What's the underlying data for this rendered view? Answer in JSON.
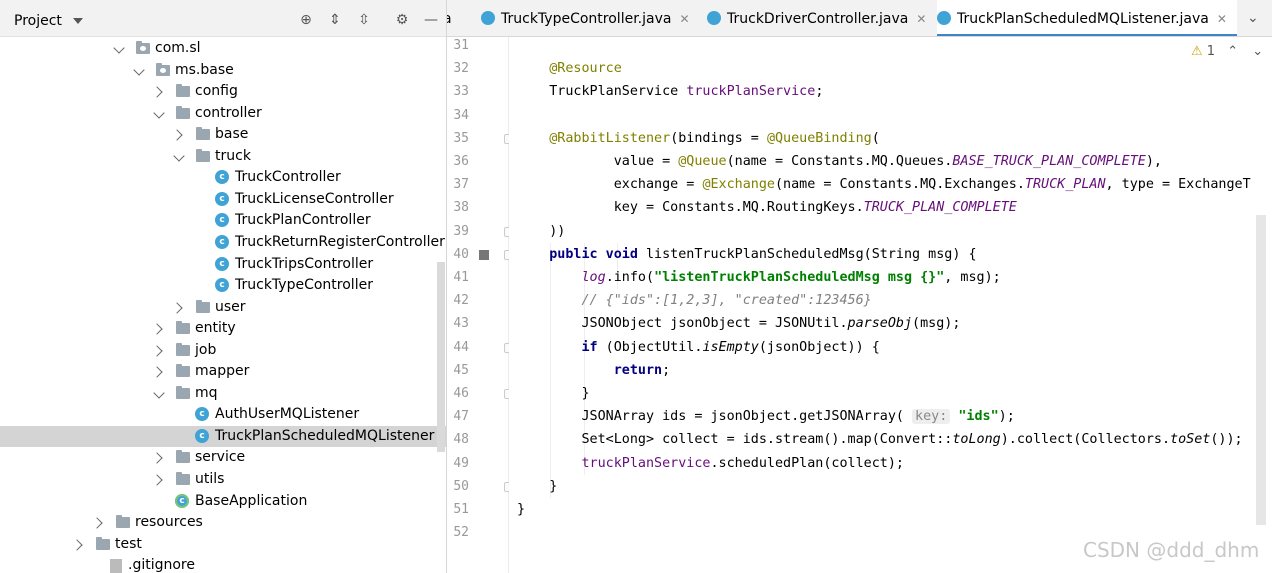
{
  "project_panel": {
    "title": "Project",
    "tree": [
      {
        "label": "com.sl",
        "type": "package",
        "expanded": true,
        "depth": 0
      },
      {
        "label": "ms.base",
        "type": "package",
        "expanded": true,
        "depth": 1
      },
      {
        "label": "config",
        "type": "folder",
        "expanded": false,
        "depth": 2
      },
      {
        "label": "controller",
        "type": "folder",
        "expanded": true,
        "depth": 2
      },
      {
        "label": "base",
        "type": "folder",
        "expanded": false,
        "depth": 3
      },
      {
        "label": "truck",
        "type": "folder",
        "expanded": true,
        "depth": 3
      },
      {
        "label": "TruckController",
        "type": "class",
        "depth": 4
      },
      {
        "label": "TruckLicenseController",
        "type": "class",
        "depth": 4
      },
      {
        "label": "TruckPlanController",
        "type": "class",
        "depth": 4
      },
      {
        "label": "TruckReturnRegisterController",
        "type": "class",
        "depth": 4
      },
      {
        "label": "TruckTripsController",
        "type": "class",
        "depth": 4
      },
      {
        "label": "TruckTypeController",
        "type": "class",
        "depth": 4
      },
      {
        "label": "user",
        "type": "folder",
        "expanded": false,
        "depth": 3
      },
      {
        "label": "entity",
        "type": "folder",
        "expanded": false,
        "depth": 2
      },
      {
        "label": "job",
        "type": "folder",
        "expanded": false,
        "depth": 2
      },
      {
        "label": "mapper",
        "type": "folder",
        "expanded": false,
        "depth": 2
      },
      {
        "label": "mq",
        "type": "folder",
        "expanded": true,
        "depth": 2
      },
      {
        "label": "AuthUserMQListener",
        "type": "class",
        "depth": 3
      },
      {
        "label": "TruckPlanScheduledMQListener",
        "type": "class",
        "depth": 3,
        "selected": true
      },
      {
        "label": "service",
        "type": "folder",
        "expanded": false,
        "depth": 2
      },
      {
        "label": "utils",
        "type": "folder",
        "expanded": false,
        "depth": 2
      },
      {
        "label": "BaseApplication",
        "type": "app",
        "depth": 2
      },
      {
        "label": "resources",
        "type": "folder",
        "expanded": false,
        "depth": -1
      },
      {
        "label": "test",
        "type": "folder",
        "expanded": false,
        "depth": -2
      },
      {
        "label": ".gitignore",
        "type": "file",
        "depth": -2
      }
    ]
  },
  "tabs": [
    {
      "label": "a",
      "partial": true
    },
    {
      "label": "TruckTypeController.java"
    },
    {
      "label": "TruckDriverController.java"
    },
    {
      "label": "TruckPlanScheduledMQListener.java",
      "active": true
    }
  ],
  "editor": {
    "warning_count": "1",
    "lines": [
      {
        "n": "31",
        "html": ""
      },
      {
        "n": "32",
        "html": "    <span class=\"an\">@Resource</span>"
      },
      {
        "n": "33",
        "html": "    TruckPlanService <span class=\"fld\">truckPlanService</span>;"
      },
      {
        "n": "34",
        "html": ""
      },
      {
        "n": "35",
        "html": "    <span class=\"an\">@RabbitListener</span>(bindings = <span class=\"an\">@QueueBinding</span>(",
        "fold": true
      },
      {
        "n": "36",
        "html": "            value = <span class=\"an\">@Queue</span>(name = Constants.MQ.Queues.<span class=\"cst\">BASE_TRUCK_PLAN_COMPLETE</span>),"
      },
      {
        "n": "37",
        "html": "            exchange = <span class=\"an\">@Exchange</span>(name = Constants.MQ.Exchanges.<span class=\"cst\">TRUCK_PLAN</span>, type = ExchangeT"
      },
      {
        "n": "38",
        "html": "            key = Constants.MQ.RoutingKeys.<span class=\"cst\">TRUCK_PLAN_COMPLETE</span>"
      },
      {
        "n": "39",
        "html": "    ))",
        "fold": true
      },
      {
        "n": "40",
        "html": "    <span class=\"k\">public void</span> listenTruckPlanScheduledMsg(String msg) {",
        "fold": true,
        "bookmark": true
      },
      {
        "n": "41",
        "html": "        <span class=\"cst\">log</span>.info(<span class=\"st\">\"listenTruckPlanScheduledMsg msg {}\"</span>, msg);"
      },
      {
        "n": "42",
        "html": "        <span class=\"cm\">// {\"ids\":[1,2,3], \"created\":123456}</span>"
      },
      {
        "n": "43",
        "html": "        JSONObject jsonObject = JSONUtil.<span class=\"it\">parseObj</span>(msg);"
      },
      {
        "n": "44",
        "html": "        <span class=\"k\">if</span> (ObjectUtil.<span class=\"it\">isEmpty</span>(jsonObject)) {",
        "fold": true
      },
      {
        "n": "45",
        "html": "            <span class=\"k\">return</span>;"
      },
      {
        "n": "46",
        "html": "        }",
        "fold": true
      },
      {
        "n": "47",
        "html": "        JSONArray ids = jsonObject.getJSONArray( <span class=\"hint\">key:</span> <span class=\"st\">\"ids\"</span>);"
      },
      {
        "n": "48",
        "html": "        Set&lt;Long&gt; collect = ids.stream().map(Convert::<span class=\"it\">toLong</span>).collect(Collectors.<span class=\"it\">toSet</span>());"
      },
      {
        "n": "49",
        "html": "        <span class=\"fld\">truckPlanService</span>.scheduledPlan(collect);"
      },
      {
        "n": "50",
        "html": "    }",
        "fold": true
      },
      {
        "n": "51",
        "html": "}"
      },
      {
        "n": "52",
        "html": ""
      }
    ]
  },
  "watermark": "CSDN @ddd_dhm"
}
